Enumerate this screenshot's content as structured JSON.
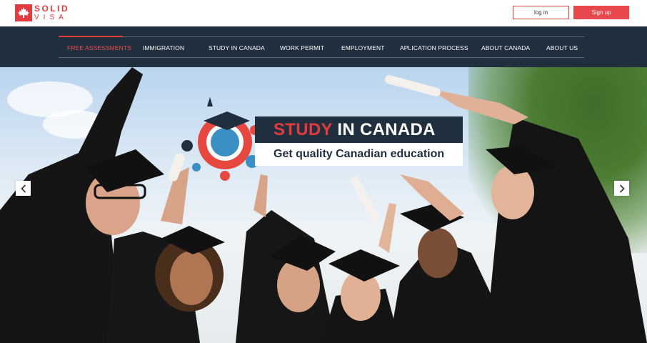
{
  "brand": {
    "line1": "SOLID",
    "line2": "VISA",
    "color": "#e23b3f"
  },
  "header": {
    "login_label": "log in",
    "signup_label": "Sign up"
  },
  "nav": {
    "items": [
      {
        "label": "FREE ASSESSMENTS",
        "active": true
      },
      {
        "label": "IMMIGRATION"
      },
      {
        "label": "STUDY IN CANADA"
      },
      {
        "label": "WORK PERMIT"
      },
      {
        "label": "EMPLOYMENT"
      },
      {
        "label": "APLICATION PROCESS"
      },
      {
        "label": "ABOUT CANADA"
      },
      {
        "label": "ABOUT US"
      }
    ]
  },
  "hero": {
    "title_accent": "STUDY",
    "title_rest": " IN CANADA",
    "subtitle": "Get quality Canadian education",
    "prev_icon": "chevron-left-icon",
    "next_icon": "chevron-right-icon"
  },
  "colors": {
    "accent": "#e23b3f",
    "navy": "#1f2f3e"
  }
}
